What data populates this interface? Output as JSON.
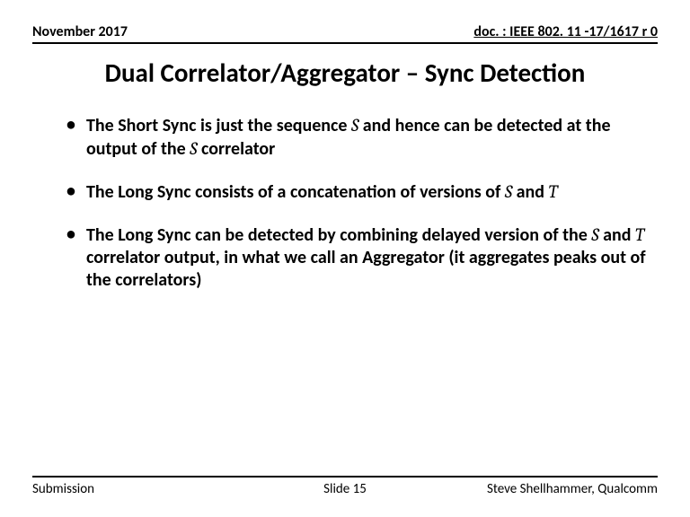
{
  "header": {
    "date": "November 2017",
    "doc_id": "doc. : IEEE 802. 11 -17/1617 r 0"
  },
  "title": "Dual Correlator/Aggregator – Sync Detection",
  "bullets": [
    {
      "pre": "The Short Sync is just the sequence ",
      "sym1": "S",
      "mid1": " and hence can be detected at the output of the ",
      "sym2": "S",
      "post": " correlator"
    },
    {
      "pre": "The Long Sync consists of a concatenation of versions of ",
      "sym1": "S",
      "mid1": " and ",
      "sym2": "T",
      "post": ""
    },
    {
      "pre": "The Long Sync can be detected by combining delayed version of the ",
      "sym1": "S",
      "mid1": " and ",
      "sym2": "T",
      "post": " correlator output, in what we call an Aggregator (it aggregates peaks out of the correlators)"
    }
  ],
  "footer": {
    "left": "Submission",
    "center": "Slide 15",
    "right": "Steve Shellhammer, Qualcomm"
  }
}
